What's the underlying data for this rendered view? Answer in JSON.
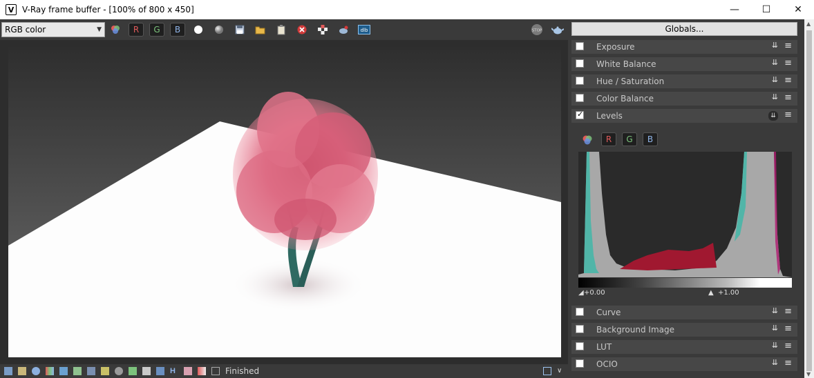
{
  "window": {
    "title": "V-Ray frame buffer - [100% of 800 x 450]",
    "controls": [
      "minimize",
      "maximize",
      "close"
    ]
  },
  "toolbar": {
    "channel_select": "RGB color",
    "channel_buttons": [
      "R",
      "G",
      "B"
    ],
    "icons": [
      "color-channels-icon",
      "white-dot-icon",
      "grey-dot-icon",
      "save-icon",
      "open-folder-icon",
      "clipboard-icon",
      "clear-icon",
      "region-icon",
      "render-teapot-icon",
      "dlb-icon",
      "stop-icon",
      "teapot-icon"
    ]
  },
  "panel": {
    "globals_label": "Globals...",
    "layers": [
      {
        "label": "Exposure",
        "checked": false
      },
      {
        "label": "White Balance",
        "checked": false
      },
      {
        "label": "Hue / Saturation",
        "checked": false
      },
      {
        "label": "Color Balance",
        "checked": false
      },
      {
        "label": "Levels",
        "checked": true
      }
    ],
    "layers_bottom": [
      {
        "label": "Curve",
        "checked": false
      },
      {
        "label": "Background Image",
        "checked": false
      },
      {
        "label": "LUT",
        "checked": false
      },
      {
        "label": "OCIO",
        "checked": false
      }
    ],
    "levels": {
      "channel_buttons": [
        "R",
        "G",
        "B"
      ],
      "low_label": "+0.00",
      "high_label": "+1.00"
    }
  },
  "status": {
    "text": "Finished"
  },
  "colors": {
    "bg": "#3a3a3a",
    "row_bg": "#474747",
    "red_channel": "#e05a5a",
    "green_channel": "#7cc27c",
    "blue_channel": "#8fb4e8",
    "histogram_fill": "#a8a8a8",
    "histogram_red": "#a01830",
    "histogram_cyan": "#3bb8a8"
  }
}
